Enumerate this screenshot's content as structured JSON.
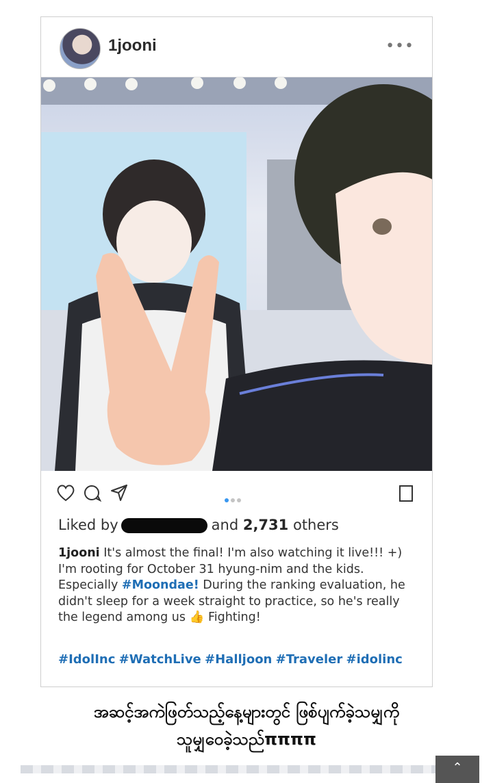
{
  "post": {
    "username": "1jooni",
    "more_icon": "more-horizontal-icon",
    "likes": {
      "prefix": "Liked by",
      "middle": "and",
      "count": "2,731",
      "suffix": "others"
    },
    "caption": {
      "user": "1jooni",
      "part1": "It's almost the final! I'm also watching it live!!! +) I'm rooting for October 31 hyung-nim and the kids. Especially",
      "tag": "#Moondae!",
      "part2": "During the ranking evaluation, he didn't sleep for a week straight to practice, so he's really the legend among us",
      "part3": "Fighting!"
    },
    "hashtags": "#IdolInc #WatchLive #Halljoon #Traveler #idolinc",
    "carousel": {
      "total": 3,
      "active": 1
    }
  },
  "translation": {
    "line1": "အဆင့်အကဲဖြတ်သည့်နေ့များတွင် ဖြစ်ပျက်ခဲ့သမျှကို",
    "line2": "သူမျှဝေခဲ့သည်ππππ"
  },
  "colors": {
    "accent_blue": "#1f6eb5",
    "dot_active": "#3897f0"
  },
  "scroll_top_icon": "chevron-up-icon"
}
